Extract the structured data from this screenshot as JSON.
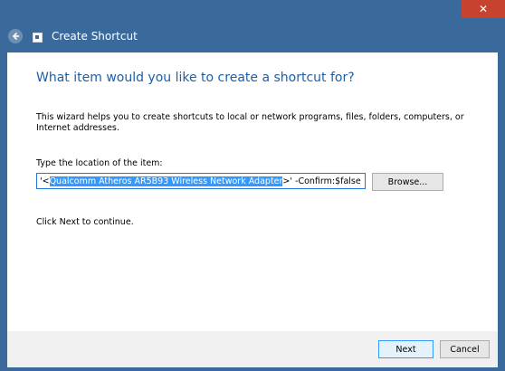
{
  "window": {
    "close_glyph": "✕",
    "title": "Create Shortcut",
    "back_icon": "back-arrow-icon",
    "app_icon": "shortcut-app-icon",
    "accent_color": "#3a6a9c",
    "close_color": "#c7432f"
  },
  "main": {
    "heading": "What item would you like to create a shortcut for?",
    "description": "This wizard helps you to create shortcuts to local or network programs, files, folders, computers, or Internet addresses.",
    "location_label": "Type the location of the item:",
    "location_value": {
      "prefix": "'<",
      "selected": "Qualcomm Atheros AR5B93 Wireless Network Adapter",
      "suffix": ">' -Confirm:$false"
    },
    "browse_label": "Browse...",
    "continue_text": "Click Next to continue.",
    "selection_color": "#3399ff"
  },
  "footer": {
    "next_label": "Next",
    "cancel_label": "Cancel"
  }
}
